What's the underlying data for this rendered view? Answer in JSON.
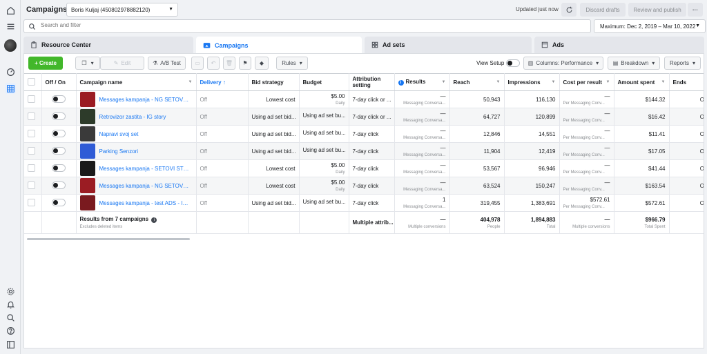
{
  "header": {
    "title": "Campaigns",
    "account": "Boris Kuljaj (450802978882120)",
    "updated": "Updated just now",
    "discard": "Discard drafts",
    "review": "Review and publish",
    "more": "···"
  },
  "search": {
    "placeholder": "Search and filter"
  },
  "daterange": "Maximum: Dec 2, 2019 – Mar 10, 2022",
  "tabs": {
    "resource": "Resource Center",
    "campaigns": "Campaigns",
    "adsets": "Ad sets",
    "ads": "Ads"
  },
  "toolbar": {
    "create": "+ Create",
    "edit": "Edit",
    "abtest": "A/B Test",
    "rules": "Rules",
    "viewsetup": "View Setup",
    "columns": "Columns: Performance",
    "breakdown": "Breakdown",
    "reports": "Reports"
  },
  "columns": {
    "onoff": "Off / On",
    "name": "Campaign name",
    "delivery": "Delivery ↑",
    "bid": "Bid strategy",
    "budget": "Budget",
    "attribution": "Attribution setting",
    "results": "Results",
    "reach": "Reach",
    "impressions": "Impressions",
    "cpr": "Cost per result",
    "spent": "Amount spent",
    "ends": "Ends"
  },
  "rows": [
    {
      "name": "Messages kampanja - NG SETOVI CA...",
      "delivery": "Off",
      "bid": "Lowest cost",
      "budget": "$5.00",
      "budget_sub": "Daily",
      "attribution": "7-day click or ...",
      "results": "—",
      "results_sub": "Messaging Conversa...",
      "reach": "50,943",
      "impressions": "116,130",
      "cpr": "—",
      "cpr_sub": "Per Messaging Conv...",
      "spent": "$144.32",
      "ends": "Ongoin",
      "thumb": "#9b1c23"
    },
    {
      "name": "Retrovizor zastita - IG story",
      "delivery": "Off",
      "bid": "Using ad set bid...",
      "budget": "Using ad set bu...",
      "budget_sub": "",
      "attribution": "7-day click or ...",
      "results": "—",
      "results_sub": "Messaging Conversa...",
      "reach": "64,727",
      "impressions": "120,899",
      "cpr": "—",
      "cpr_sub": "Per Messaging Conv...",
      "spent": "$16.42",
      "ends": "Ongoin",
      "thumb": "#2d3b2a"
    },
    {
      "name": "Napravi svoj set",
      "delivery": "Off",
      "bid": "Using ad set bid...",
      "budget": "Using ad set bu...",
      "budget_sub": "",
      "attribution": "7-day click",
      "results": "—",
      "results_sub": "Messaging Conversa...",
      "reach": "12,846",
      "impressions": "14,551",
      "cpr": "—",
      "cpr_sub": "Per Messaging Conv...",
      "spent": "$11.41",
      "ends": "Ongoin",
      "thumb": "#3a3a3a"
    },
    {
      "name": "Parking Senzori",
      "delivery": "Off",
      "bid": "Using ad set bid...",
      "budget": "Using ad set bu...",
      "budget_sub": "",
      "attribution": "7-day click",
      "results": "—",
      "results_sub": "Messaging Conversa...",
      "reach": "11,904",
      "impressions": "12,419",
      "cpr": "—",
      "cpr_sub": "Per Messaging Conv...",
      "spent": "$17.05",
      "ends": "Ongoin",
      "thumb": "#2f5bd6"
    },
    {
      "name": "Messages kampanja - SETOVI STORY",
      "delivery": "Off",
      "bid": "Lowest cost",
      "budget": "$5.00",
      "budget_sub": "Daily",
      "attribution": "7-day click",
      "results": "—",
      "results_sub": "Messaging Conversa...",
      "reach": "53,567",
      "impressions": "96,946",
      "cpr": "—",
      "cpr_sub": "Per Messaging Conv...",
      "spent": "$41.44",
      "ends": "Ongoin",
      "thumb": "#1a1a1a"
    },
    {
      "name": "Messages kampanja - NG SETOVI CA...",
      "delivery": "Off",
      "bid": "Lowest cost",
      "budget": "$5.00",
      "budget_sub": "Daily",
      "attribution": "7-day click",
      "results": "—",
      "results_sub": "Messaging Conversa...",
      "reach": "63,524",
      "impressions": "150,247",
      "cpr": "—",
      "cpr_sub": "Per Messaging Conv...",
      "spent": "$163.54",
      "ends": "Ongoin",
      "thumb": "#9b1c23"
    },
    {
      "name": "Messages kampanja - test ADS - Inst...",
      "delivery": "Off",
      "bid": "Using ad set bid...",
      "budget": "Using ad set bu...",
      "budget_sub": "",
      "attribution": "7-day click",
      "results": "1",
      "results_sub": "Messaging Conversa...",
      "reach": "319,455",
      "impressions": "1,383,691",
      "cpr": "$572.61",
      "cpr_sub": "Per Messaging Conv...",
      "spent": "$572.61",
      "ends": "Ongoin",
      "thumb": "#7a1a1f"
    }
  ],
  "summary": {
    "label": "Results from 7 campaigns",
    "sub": "Excludes deleted items",
    "attribution": "Multiple attrib...",
    "results": "—",
    "results_sub": "Multiple conversions",
    "reach": "404,978",
    "reach_sub": "People",
    "impressions": "1,894,883",
    "impressions_sub": "Total",
    "cpr": "—",
    "cpr_sub": "Multiple conversions",
    "spent": "$966.79",
    "spent_sub": "Total Spent"
  }
}
